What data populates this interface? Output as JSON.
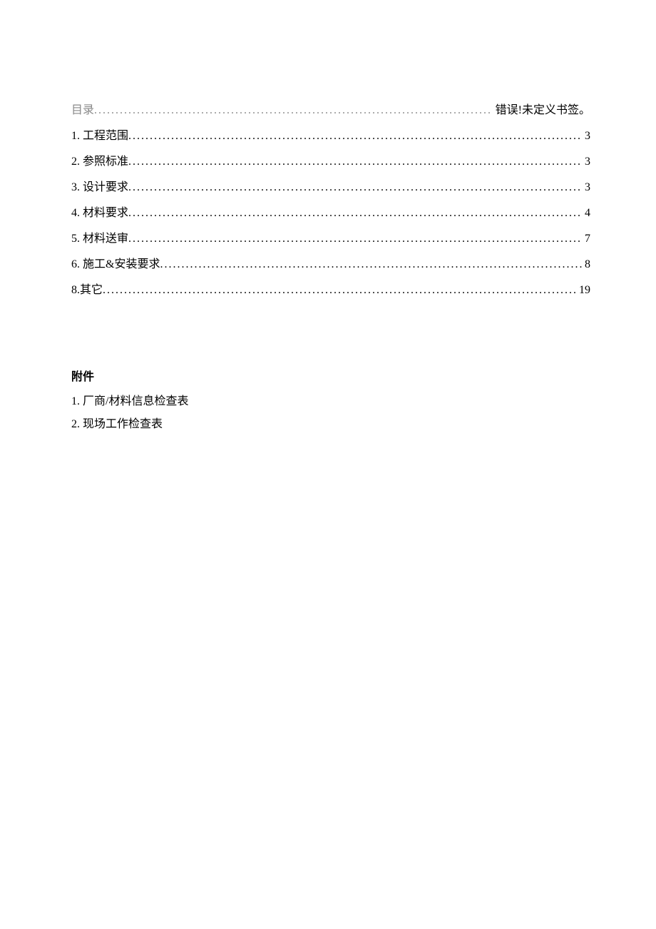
{
  "toc": [
    {
      "label": "目录",
      "page": "错误!未定义书签。",
      "is_mulu": true
    },
    {
      "label": "1.  工程范围",
      "page": "3",
      "is_mulu": false
    },
    {
      "label": "2.  参照标准",
      "page": "3",
      "is_mulu": false
    },
    {
      "label": "3.  设计要求",
      "page": "3",
      "is_mulu": false
    },
    {
      "label": "4.  材料要求",
      "page": "4",
      "is_mulu": false
    },
    {
      "label": "5.  材料送审",
      "page": "7",
      "is_mulu": false
    },
    {
      "label": "6.  施工&安装要求",
      "page": "8",
      "is_mulu": false
    },
    {
      "label": "8.其它",
      "page": "19",
      "is_mulu": false
    }
  ],
  "attachments": {
    "heading": "附件",
    "items": [
      "1.  厂商/材料信息检查表",
      "2.  现场工作检查表"
    ]
  },
  "dots": "........................................................................................................................"
}
